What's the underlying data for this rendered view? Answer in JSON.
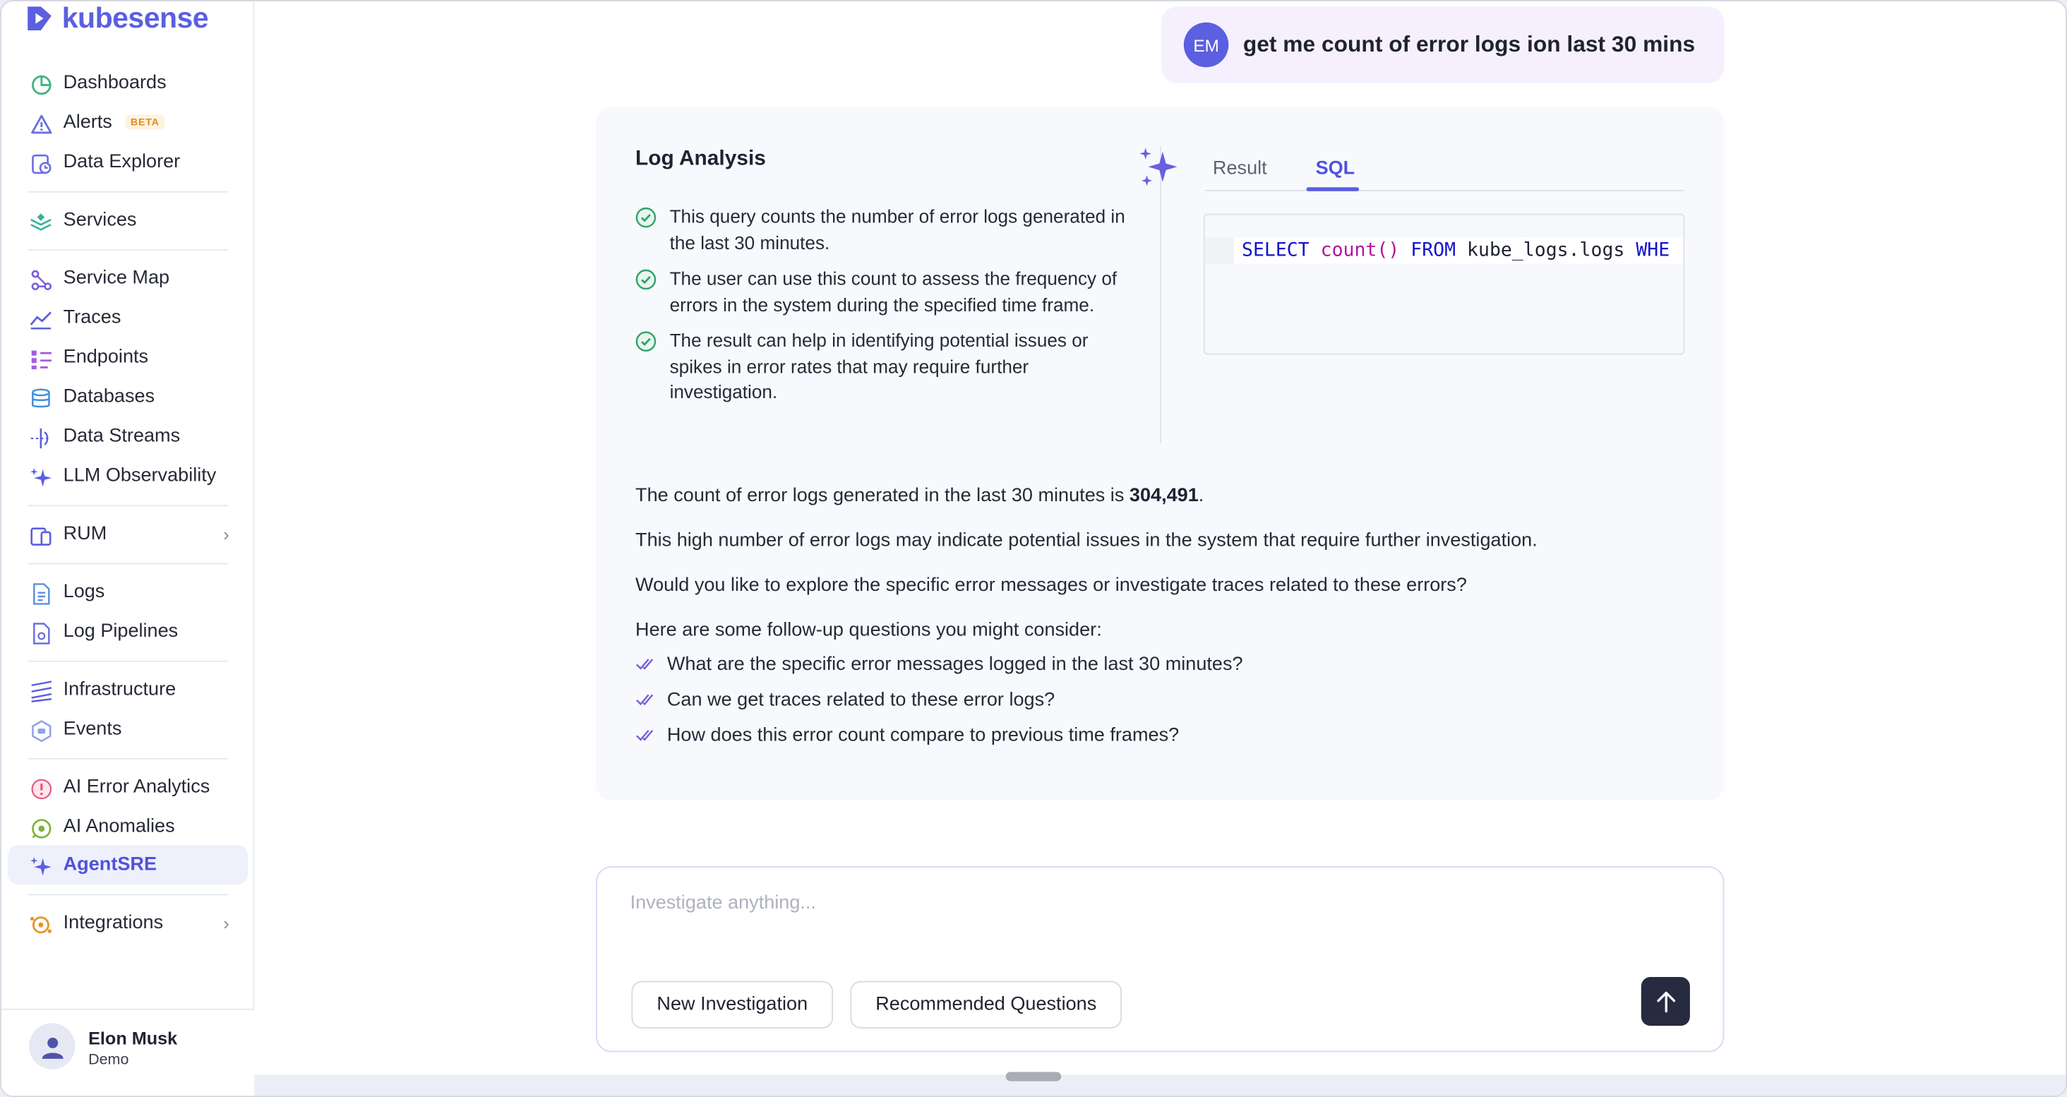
{
  "brand": {
    "name": "kubesense"
  },
  "sidebar": {
    "items": [
      {
        "label": "Dashboards",
        "icon": "dashboard-icon"
      },
      {
        "label": "Alerts",
        "icon": "alert-icon",
        "badge": "BETA"
      },
      {
        "label": "Data Explorer",
        "icon": "data-explorer-icon"
      },
      {
        "label": "Services",
        "icon": "services-icon"
      },
      {
        "label": "Service Map",
        "icon": "service-map-icon"
      },
      {
        "label": "Traces",
        "icon": "traces-icon"
      },
      {
        "label": "Endpoints",
        "icon": "endpoints-icon"
      },
      {
        "label": "Databases",
        "icon": "databases-icon"
      },
      {
        "label": "Data Streams",
        "icon": "data-streams-icon"
      },
      {
        "label": "LLM Observability",
        "icon": "llm-icon"
      },
      {
        "label": "RUM",
        "icon": "rum-icon"
      },
      {
        "label": "Logs",
        "icon": "logs-icon"
      },
      {
        "label": "Log Pipelines",
        "icon": "log-pipelines-icon"
      },
      {
        "label": "Infrastructure",
        "icon": "infrastructure-icon"
      },
      {
        "label": "Events",
        "icon": "events-icon"
      },
      {
        "label": "AI Error Analytics",
        "icon": "ai-error-icon"
      },
      {
        "label": "AI Anomalies",
        "icon": "ai-anomalies-icon"
      },
      {
        "label": "AgentSRE",
        "icon": "agent-sre-icon",
        "active": true
      },
      {
        "label": "Integrations",
        "icon": "integrations-icon"
      }
    ],
    "user": {
      "name": "Elon Musk",
      "role": "Demo"
    }
  },
  "chat": {
    "user_message": {
      "initials": "EM",
      "text": "get me count of error logs ion last 30 mins"
    },
    "analysis": {
      "title": "Log Analysis",
      "bullets": [
        "This query counts the number of error logs generated in the last 30 minutes.",
        "The user can use this count to assess the frequency of errors in the system during the specified time frame.",
        "The result can help in identifying potential issues or spikes in error rates that may require further investigation."
      ],
      "tabs": [
        "Result",
        "SQL"
      ],
      "active_tab": "SQL",
      "sql": {
        "kw1": "SELECT",
        "fn": "count()",
        "kw2": "FROM",
        "table": "kube_logs.logs",
        "kw3": "WHE"
      }
    },
    "answer": {
      "count_prefix": "The count of error logs generated in the last 30 minutes is",
      "count_value": "304,491",
      "count_suffix": ".",
      "p2": "This high number of error logs may indicate potential issues in the system that require further investigation.",
      "p3": "Would you like to explore the specific error messages or investigate traces related to these errors?",
      "p4": "Here are some follow-up questions you might consider:",
      "followups": [
        "What are the specific error messages logged in the last 30 minutes?",
        "Can we get traces related to these error logs?",
        "How does this error count compare to previous time frames?"
      ]
    }
  },
  "composer": {
    "placeholder": "Investigate anything...",
    "new_investigation": "New Investigation",
    "recommended": "Recommended Questions"
  },
  "colors": {
    "accent": "#5b5fe0",
    "active_bg": "#eef0fc",
    "send_bg": "#262b40",
    "success": "#2fa36b"
  }
}
